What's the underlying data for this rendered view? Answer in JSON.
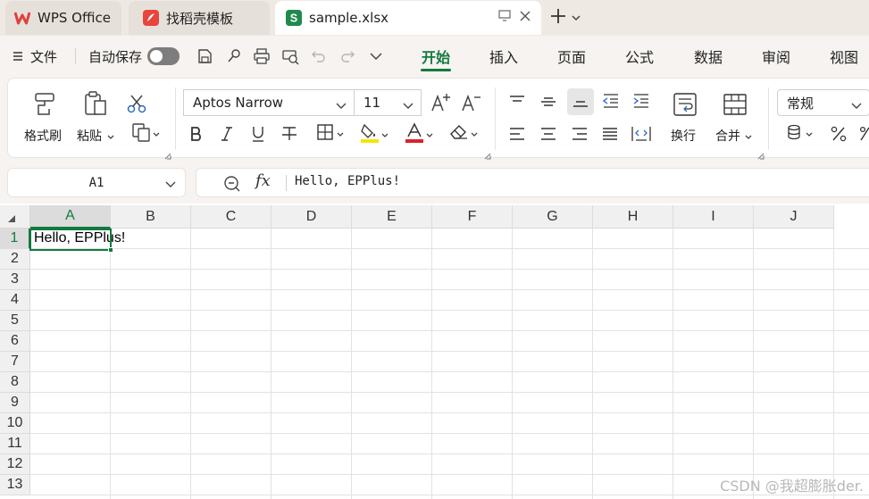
{
  "tabs": [
    {
      "label": "WPS Office"
    },
    {
      "label": "找稻壳模板"
    },
    {
      "label": "sample.xlsx"
    }
  ],
  "menu": {
    "file": "文件",
    "autosave": "自动保存"
  },
  "ribbon_tabs": [
    "开始",
    "插入",
    "页面",
    "公式",
    "数据",
    "审阅",
    "视图"
  ],
  "ribbon": {
    "format_painter": "格式刷",
    "paste": "粘贴",
    "font_name": "Aptos Narrow",
    "font_size": "11",
    "wrap": "换行",
    "merge": "合并",
    "number_format": "常规"
  },
  "formula_bar": {
    "name_box": "A1",
    "fx": "fx",
    "content": "Hello, EPPlus!"
  },
  "grid": {
    "columns": [
      "A",
      "B",
      "C",
      "D",
      "E",
      "F",
      "G",
      "H",
      "I",
      "J"
    ],
    "rows": [
      "1",
      "2",
      "3",
      "4",
      "5",
      "6",
      "7",
      "8",
      "9",
      "10",
      "11",
      "12",
      "13"
    ],
    "cell_a1": "Hello, EPPlus!"
  },
  "watermark": "CSDN @我超膨胀der.",
  "colors": {
    "accent": "#127a3f",
    "wps_red": "#e0403a",
    "sheet_green": "#1e8a4c"
  }
}
